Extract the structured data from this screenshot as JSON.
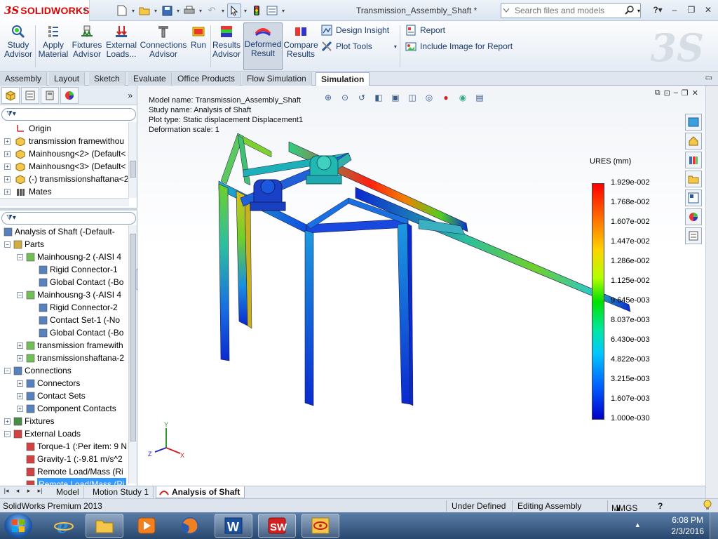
{
  "app": {
    "logo_text": "SOLIDWORKS",
    "logo_prefix": "3S",
    "document_title": "Transmission_Assembly_Shaft *",
    "search_placeholder": "Search files and models",
    "help_label": "?"
  },
  "ribbon": {
    "buttons": [
      {
        "label1": "Study",
        "label2": "Advisor",
        "icon": "study-advisor-icon"
      },
      {
        "label1": "Apply",
        "label2": "Material",
        "icon": "apply-material-icon"
      },
      {
        "label1": "Fixtures",
        "label2": "Advisor",
        "icon": "fixtures-icon"
      },
      {
        "label1": "External",
        "label2": "Loads...",
        "icon": "external-loads-icon"
      },
      {
        "label1": "Connections",
        "label2": "Advisor",
        "icon": "connections-icon"
      },
      {
        "label1": "Run",
        "label2": "",
        "icon": "run-icon"
      },
      {
        "label1": "Results",
        "label2": "Advisor",
        "icon": "results-advisor-icon"
      },
      {
        "label1": "Deformed",
        "label2": "Result",
        "icon": "deformed-result-icon"
      },
      {
        "label1": "Compare",
        "label2": "Results",
        "icon": "compare-results-icon"
      }
    ],
    "small": {
      "design_insight": "Design Insight",
      "plot_tools": "Plot Tools",
      "report": "Report",
      "include_image": "Include Image for Report"
    }
  },
  "command_tabs": [
    "Assembly",
    "Layout",
    "Sketch",
    "Evaluate",
    "Office Products",
    "Flow Simulation",
    "Simulation"
  ],
  "active_command_tab": "Simulation",
  "feature_tree": {
    "filter_label": "▾",
    "items": [
      {
        "label": "Origin",
        "icon": "origin-icon"
      },
      {
        "label": "transmission framewithou",
        "icon": "part-icon"
      },
      {
        "label": "Mainhousng<2> (Default<",
        "icon": "part-icon"
      },
      {
        "label": "Mainhousng<3> (Default<",
        "icon": "part-icon"
      },
      {
        "label": "(-) transmissionshaftana<2",
        "icon": "part-icon"
      },
      {
        "label": "Mates",
        "icon": "mates-icon"
      }
    ]
  },
  "study_tree": {
    "items": [
      {
        "label": "Analysis of Shaft (-Default-",
        "level": 0
      },
      {
        "label": "Parts",
        "level": 1
      },
      {
        "label": "Mainhousng-2 (-AISI 4",
        "level": 2
      },
      {
        "label": "Rigid Connector-1",
        "level": 3
      },
      {
        "label": "Global Contact (-Bo",
        "level": 3
      },
      {
        "label": "Mainhousng-3 (-AISI 4",
        "level": 2
      },
      {
        "label": "Rigid Connector-2",
        "level": 3
      },
      {
        "label": "Contact Set-1 (-No",
        "level": 3
      },
      {
        "label": "Global Contact (-Bo",
        "level": 3
      },
      {
        "label": "transmission framewith",
        "level": 2
      },
      {
        "label": "transmissionshaftana-2",
        "level": 2
      },
      {
        "label": "Connections",
        "level": 1
      },
      {
        "label": "Connectors",
        "level": 2
      },
      {
        "label": "Contact Sets",
        "level": 2
      },
      {
        "label": "Component Contacts",
        "level": 2
      },
      {
        "label": "Fixtures",
        "level": 1
      },
      {
        "label": "External Loads",
        "level": 1
      },
      {
        "label": "Torque-1 (:Per item: 9 N",
        "level": 2
      },
      {
        "label": "Gravity-1 (:-9.81 m/s^2",
        "level": 2
      },
      {
        "label": "Remote Load/Mass (Ri",
        "level": 2
      },
      {
        "label": "Remote Load/Mass (Ri",
        "level": 2
      }
    ]
  },
  "plot": {
    "model_name": "Model name: Transmission_Assembly_Shaft",
    "study_name": "Study name: Analysis of Shaft",
    "plot_type": "Plot type: Static displacement Displacement1",
    "deformation_scale": "Deformation scale: 1",
    "legend_title": "URES (mm)",
    "legend_values": [
      "1.929e-002",
      "1.768e-002",
      "1.607e-002",
      "1.447e-002",
      "1.286e-002",
      "1.125e-002",
      "9.645e-003",
      "8.037e-003",
      "6.430e-003",
      "4.822e-003",
      "3.215e-003",
      "1.607e-003",
      "1.000e-030"
    ],
    "legend_colors": {
      "max": "#ff0000",
      "mid": "#00e000",
      "min": "#0000cc"
    },
    "triad": {
      "x": "X",
      "y": "Y",
      "z": "Z"
    }
  },
  "bottom_tabs": [
    "Model",
    "Motion Study 1",
    "Analysis of Shaft"
  ],
  "active_bottom_tab": "Analysis of Shaft",
  "status": {
    "product": "SolidWorks Premium 2013",
    "definition": "Under Defined",
    "mode": "Editing Assembly",
    "units": "MMGS",
    "units_drop": "▴",
    "help": "?"
  },
  "taskbar": {
    "time": "6:08 PM",
    "date": "2/3/2016",
    "apps": [
      "internet-explorer-icon",
      "file-explorer-icon",
      "media-player-icon",
      "firefox-icon",
      "word-icon",
      "solidworks-icon",
      "app-icon"
    ]
  }
}
